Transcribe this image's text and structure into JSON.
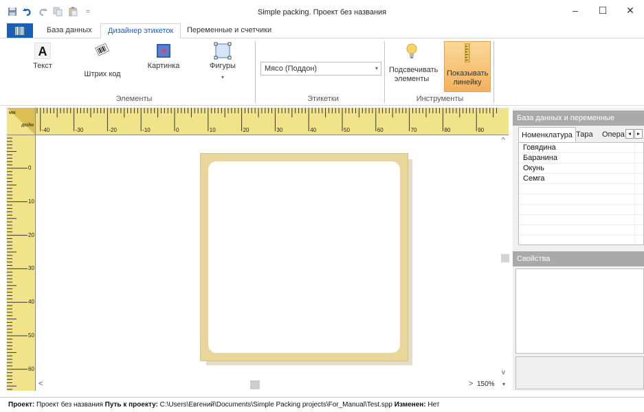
{
  "window": {
    "title": "Simple packing. Проект без названия",
    "buttons": {
      "minimize": "–",
      "maximize": "☐",
      "close": "✕"
    }
  },
  "qat": {
    "separator_glyph": "="
  },
  "tabs": [
    {
      "label": "База данных"
    },
    {
      "label": "Дизайнер этикеток"
    },
    {
      "label": "Переменные и счетчики"
    }
  ],
  "ribbon": {
    "elements": {
      "text": "Текст",
      "barcode": "Штрих код",
      "picture": "Картинка",
      "shapes": "Фигуры",
      "shapes_dropdown": "▾",
      "group": "Элементы"
    },
    "labels": {
      "combo_value": "Мясо (Поддон)",
      "group": "Этикетки"
    },
    "tools": {
      "highlight": "Подсвечивать элементы",
      "ruler": "Показывать линейку",
      "group": "Инструменты"
    }
  },
  "ruler": {
    "corner_top": "мм",
    "corner_bottom": "дюйм",
    "h_labels": [
      "-40",
      "-30",
      "-20",
      "-10",
      "0",
      "10",
      "20",
      "30",
      "40",
      "50",
      "60",
      "70",
      "80",
      "90"
    ],
    "v_labels": [
      "0",
      "10",
      "20",
      "30",
      "40",
      "50",
      "60"
    ]
  },
  "canvas": {
    "scroll_left": "<",
    "scroll_right": ">",
    "scroll_up": "^",
    "scroll_down": "v",
    "zoom": "150%",
    "zoom_dropdown": "▾"
  },
  "panel": {
    "db_title": "База данных и переменные",
    "tabs": [
      "Номенклатура",
      "Тара",
      "Опера"
    ],
    "nav_prev": "◂",
    "nav_next": "▸",
    "items": [
      "Говядина",
      "Баранина",
      "Окунь",
      "Семга"
    ],
    "props_title": "Свойства"
  },
  "status": {
    "project_label": "Проект:",
    "project_value": "Проект без названия",
    "path_label": "Путь к проекту:",
    "path_value": "C:\\Users\\Евгений\\Documents\\Simple Packing projects\\For_Manual\\Test.spp",
    "modified_label": "Изменен:",
    "modified_value": "Нет"
  }
}
